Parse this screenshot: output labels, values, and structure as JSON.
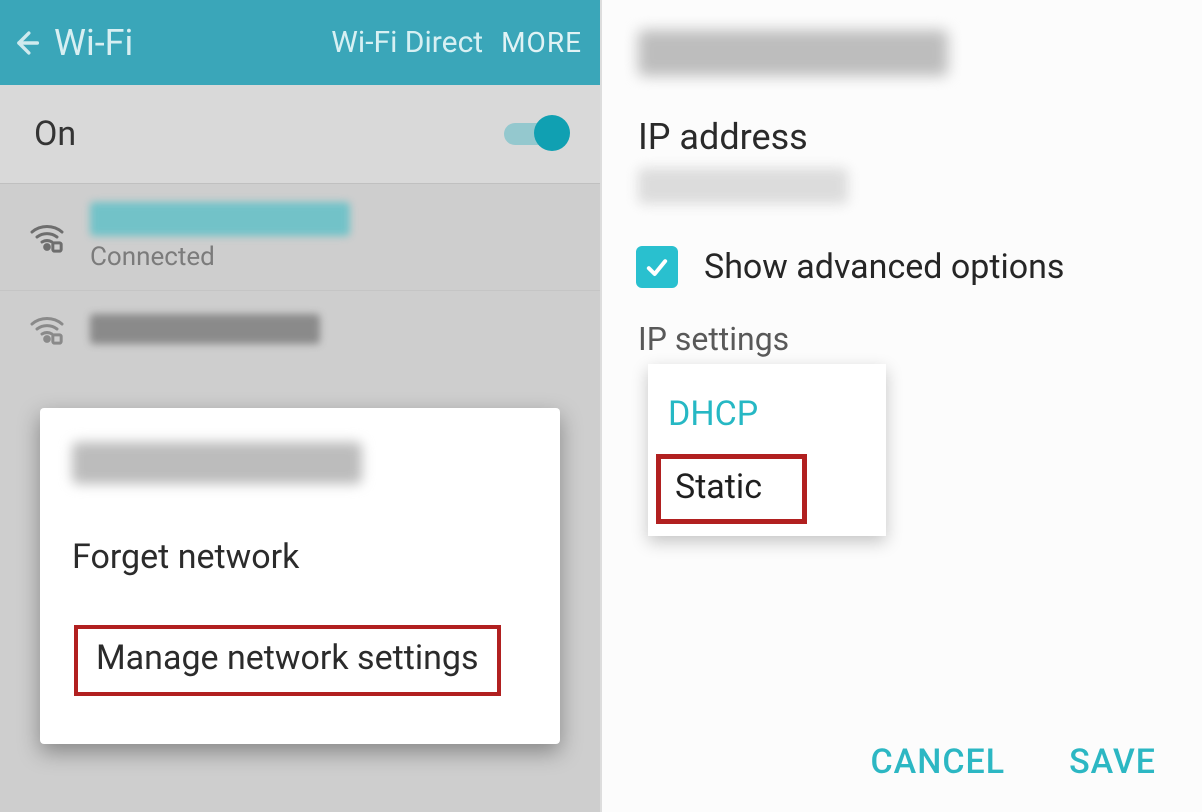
{
  "left": {
    "header": {
      "title": "Wi-Fi",
      "wifi_direct": "Wi-Fi Direct",
      "more": "MORE"
    },
    "toggle": {
      "label": "On",
      "on": true
    },
    "networks": [
      {
        "status": "Connected"
      }
    ],
    "popup": {
      "forget": "Forget network",
      "manage": "Manage network settings"
    }
  },
  "right": {
    "ip_label": "IP address",
    "adv_label": "Show advanced options",
    "adv_checked": true,
    "ip_settings_label": "IP settings",
    "dropdown": {
      "dhcp": "DHCP",
      "static": "Static"
    },
    "behind_text": "None",
    "actions": {
      "cancel": "CANCEL",
      "save": "SAVE"
    }
  }
}
